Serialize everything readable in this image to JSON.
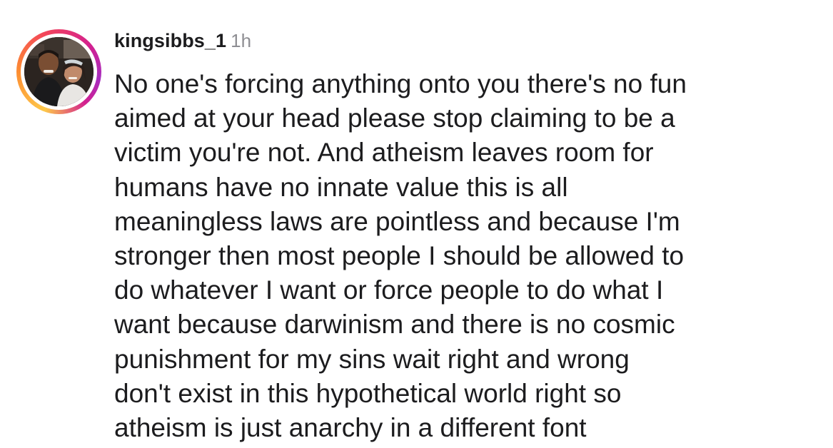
{
  "comment": {
    "username": "kingsibbs_1",
    "timestamp": "1h",
    "avatar_icon": "profile-photo",
    "story_ring_colors": [
      "#fdc84a",
      "#fd8d32",
      "#f3455a",
      "#d3208f",
      "#a62cbf"
    ],
    "text_lines": [
      "No one's forcing anything onto you there's no fun",
      "aimed at your head please stop claiming to be a",
      "victim you're not. And atheism leaves room for",
      "humans have no innate value this is all",
      "meaningless laws are pointless and because I'm",
      "stronger then most people I should be allowed to",
      "do whatever I want or force people to do what I",
      "want because darwinism and there is no cosmic",
      "punishment for my sins wait right and wrong",
      "don't exist in this hypothetical world right so",
      "atheism is just anarchy in a different font"
    ]
  }
}
